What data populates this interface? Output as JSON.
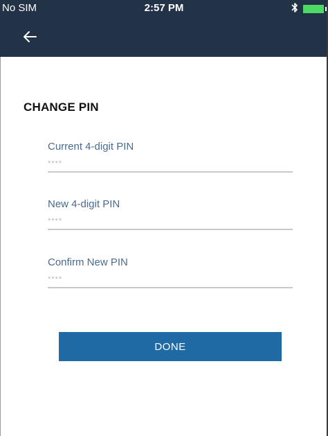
{
  "status_bar": {
    "carrier": "No SIM",
    "time": "2:57 PM",
    "bluetooth_icon": "bluetooth-icon",
    "battery_icon": "battery-icon"
  },
  "nav_bar": {
    "back_icon": "arrow-left-icon",
    "background_color": "#223247"
  },
  "main": {
    "title": "CHANGE PIN",
    "fields": [
      {
        "label": "Current 4-digit PIN",
        "placeholder": "****",
        "value": ""
      },
      {
        "label": "New 4-digit PIN",
        "placeholder": "****",
        "value": ""
      },
      {
        "label": "Confirm New PIN",
        "placeholder": "****",
        "value": ""
      }
    ],
    "done_button": {
      "label": "DONE",
      "color": "#1f6aa5"
    }
  },
  "colors": {
    "header": "#223247",
    "label": "#4a6a8e",
    "accent": "#1f6aa5",
    "battery": "#4cd964"
  }
}
